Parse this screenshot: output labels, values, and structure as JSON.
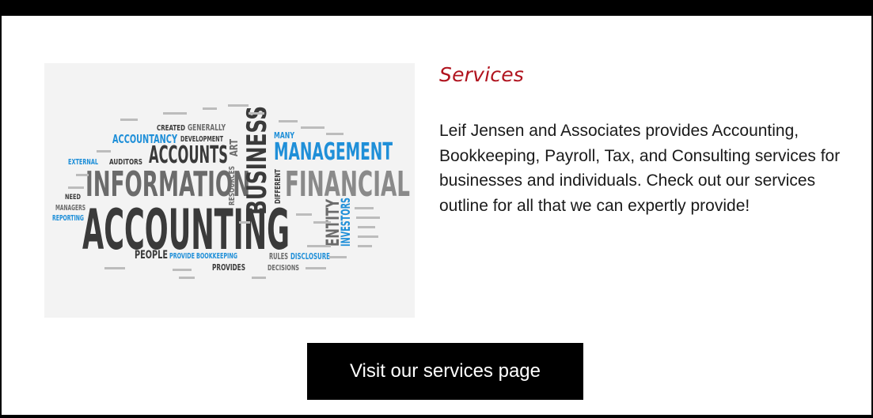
{
  "services": {
    "title": "Services",
    "description": "Leif Jensen and Associates provides Accounting, Bookkeeping, Payroll, Tax, and Consulting services for businesses and individuals. Check out our services outline for all that we can expertly provide!",
    "button_label": "Visit our services page"
  },
  "word_cloud": {
    "accounting": "ACCOUNTING",
    "information": "INFORMATION",
    "accounts": "ACCOUNTS",
    "business": "BUSINESS",
    "management": "MANAGEMENT",
    "financial": "FINANCIAL",
    "accountancy": "ACCOUNTANCY",
    "external": "EXTERNAL",
    "auditors": "AUDITORS",
    "created": "CREATED",
    "generally": "GENERALLY",
    "development": "DEVELOPMENT",
    "people": "PEOPLE",
    "provide": "PROVIDE",
    "bookkeeping": "BOOKKEEPING",
    "rules": "RULES",
    "disclosure": "DISCLOSURE",
    "provides": "PROVIDES",
    "decisions": "DECISIONS",
    "entity": "ENTITY",
    "investors": "INVESTORS",
    "different": "DIFFERENT",
    "many": "MANY",
    "resources": "RESOURCES",
    "art": "ART",
    "managers": "MANAGERS",
    "reporting": "REPORTING",
    "need": "NEED",
    "accent_blue": "#1f8fd8",
    "dark_gray": "#3a3a3a",
    "mid_gray": "#6b6b6b",
    "light_gray": "#8a8a8a"
  }
}
